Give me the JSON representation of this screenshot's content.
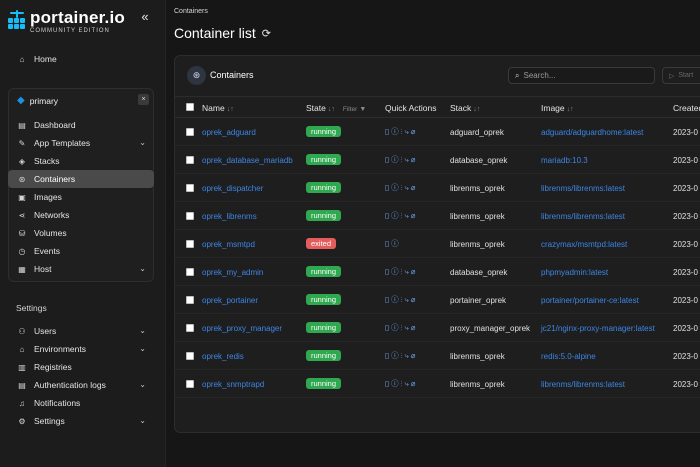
{
  "brand": {
    "title": "portainer.io",
    "subtitle": "COMMUNITY EDITION"
  },
  "sidebar": {
    "collapse_icon": "«",
    "home": "Home",
    "environment": {
      "name": "primary",
      "close": "×"
    },
    "env_items": [
      {
        "label": "Dashboard",
        "icon": "dashboard-icon",
        "glyph": "▤"
      },
      {
        "label": "App Templates",
        "icon": "templates-icon",
        "glyph": "✎",
        "chevron": "⌄"
      },
      {
        "label": "Stacks",
        "icon": "stacks-icon",
        "glyph": "◈"
      },
      {
        "label": "Containers",
        "icon": "containers-icon",
        "glyph": "⊛",
        "active": true
      },
      {
        "label": "Images",
        "icon": "images-icon",
        "glyph": "▣"
      },
      {
        "label": "Networks",
        "icon": "networks-icon",
        "glyph": "⋖"
      },
      {
        "label": "Volumes",
        "icon": "volumes-icon",
        "glyph": "⛁"
      },
      {
        "label": "Events",
        "icon": "events-icon",
        "glyph": "◷"
      },
      {
        "label": "Host",
        "icon": "host-icon",
        "glyph": "▦",
        "chevron": "⌄"
      }
    ],
    "settings_heading": "Settings",
    "settings_items": [
      {
        "label": "Users",
        "icon": "users-icon",
        "glyph": "⚇",
        "chevron": "⌄"
      },
      {
        "label": "Environments",
        "icon": "environments-icon",
        "glyph": "⌂",
        "chevron": "⌄"
      },
      {
        "label": "Registries",
        "icon": "registries-icon",
        "glyph": "▥"
      },
      {
        "label": "Authentication logs",
        "icon": "auth-logs-icon",
        "glyph": "▤",
        "chevron": "⌄"
      },
      {
        "label": "Notifications",
        "icon": "bell-icon",
        "glyph": "♫"
      },
      {
        "label": "Settings",
        "icon": "gear-icon",
        "glyph": "⚙",
        "chevron": "⌄"
      }
    ]
  },
  "header": {
    "breadcrumb": "Containers",
    "title": "Container list",
    "refresh_icon": "⟳"
  },
  "panel": {
    "title": "Containers",
    "search_placeholder": "Search...",
    "start_button": "Start",
    "columns": {
      "name": "Name",
      "state": "State",
      "filter": "Filter",
      "quick_actions": "Quick Actions",
      "stack": "Stack",
      "image": "Image",
      "created": "Created"
    }
  },
  "colors": {
    "running": "#2fa84f",
    "exited": "#e35d5d",
    "link": "#3d86e6",
    "brand": "#13bef9"
  },
  "containers": [
    {
      "name": "oprek_adguard",
      "state": "running",
      "quick_actions": "▯ⓘ⫶⤷⌀",
      "stack": "adguard_oprek",
      "image": "adguard/adguardhome:latest",
      "created": "2023-0"
    },
    {
      "name": "oprek_database_mariadb",
      "state": "running",
      "quick_actions": "▯ⓘ⫶⤷⌀",
      "stack": "database_oprek",
      "image": "mariadb:10.3",
      "created": "2023-0"
    },
    {
      "name": "oprek_dispatcher",
      "state": "running",
      "quick_actions": "▯ⓘ⫶⤷⌀",
      "stack": "librenms_oprek",
      "image": "librenms/librenms:latest",
      "created": "2023-0"
    },
    {
      "name": "oprek_librenms",
      "state": "running",
      "quick_actions": "▯ⓘ⫶⤷⌀",
      "stack": "librenms_oprek",
      "image": "librenms/librenms:latest",
      "created": "2023-0"
    },
    {
      "name": "oprek_msmtpd",
      "state": "exited",
      "quick_actions": "▯ⓘ",
      "stack": "librenms_oprek",
      "image": "crazymax/msmtpd:latest",
      "created": "2023-0"
    },
    {
      "name": "oprek_my_admin",
      "state": "running",
      "quick_actions": "▯ⓘ⫶⤷⌀",
      "stack": "database_oprek",
      "image": "phpmyadmin:latest",
      "created": "2023-0"
    },
    {
      "name": "oprek_portainer",
      "state": "running",
      "quick_actions": "▯ⓘ⫶⤷⌀",
      "stack": "portainer_oprek",
      "image": "portainer/portainer-ce:latest",
      "created": "2023-0"
    },
    {
      "name": "oprek_proxy_manager",
      "state": "running",
      "quick_actions": "▯ⓘ⫶⤷⌀",
      "stack": "proxy_manager_oprek",
      "image": "jc21/nginx-proxy-manager:latest",
      "created": "2023-0"
    },
    {
      "name": "oprek_redis",
      "state": "running",
      "quick_actions": "▯ⓘ⫶⤷⌀",
      "stack": "librenms_oprek",
      "image": "redis:5.0-alpine",
      "created": "2023-0"
    },
    {
      "name": "oprek_snmptrapd",
      "state": "running",
      "quick_actions": "▯ⓘ⫶⤷⌀",
      "stack": "librenms_oprek",
      "image": "librenms/librenms:latest",
      "created": "2023-0"
    }
  ]
}
